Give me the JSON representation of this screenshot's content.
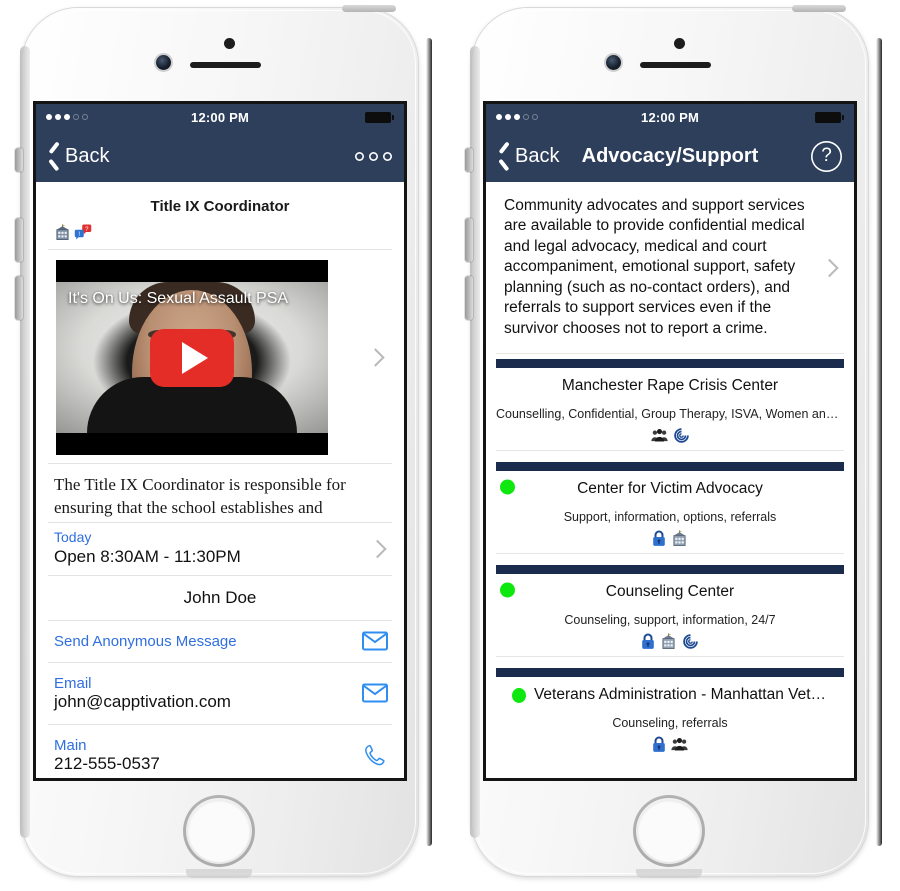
{
  "phones": {
    "left": {
      "statusbar": {
        "signal_filled": 3,
        "signal_empty": 2,
        "time": "12:00 PM"
      },
      "nav": {
        "back_label": "Back",
        "title": "",
        "right_icon": "kebab-more-icon"
      },
      "page_title": "Title IX Coordinator",
      "tag_icons": [
        "building-icon",
        "question-exclamation-bubbles-icon"
      ],
      "video": {
        "title": "It's On Us: Sexual Assault PSA",
        "play_icon": "youtube-play-icon"
      },
      "description": "The Title IX Coordinator is responsible for ensuring that the school establishes and",
      "hours": {
        "label": "Today",
        "value": "Open  8:30AM - 11:30PM"
      },
      "contact_name": "John Doe",
      "actions": [
        {
          "label": "Send Anonymous Message",
          "icon": "envelope-icon"
        }
      ],
      "fields": [
        {
          "label": "Email",
          "value": "john@capptivation.com",
          "icon": "envelope-icon"
        },
        {
          "label": "Main",
          "value": "212-555-0537",
          "icon": "phone-icon"
        }
      ]
    },
    "right": {
      "statusbar": {
        "signal_filled": 3,
        "signal_empty": 2,
        "time": "12:00 PM"
      },
      "nav": {
        "back_label": "Back",
        "title": "Advocacy/Support",
        "help_label": "?",
        "right_icon": "help-circle-icon"
      },
      "intro": "Community advocates and support services are available to provide confidential medical and legal advocacy, medical and court accompaniment, emotional support, safety planning (such as no-contact orders), and referrals to support services even if the survivor chooses not to report a crime.",
      "cards": [
        {
          "title": "Manchester Rape Crisis Center",
          "subtitle": "Counselling, Confidential, Group Therapy, ISVA, Women and girl…",
          "status_dot": false,
          "icons": [
            "group-people-icon",
            "swirl-icon"
          ]
        },
        {
          "title": "Center for Victim Advocacy",
          "subtitle": "Support, information, options, referrals",
          "status_dot": true,
          "icons": [
            "lock-icon",
            "building-icon"
          ]
        },
        {
          "title": "Counseling Center",
          "subtitle": "Counseling, support, information, 24/7",
          "status_dot": true,
          "icons": [
            "lock-icon",
            "building-icon",
            "swirl-icon"
          ]
        },
        {
          "title": "Veterans Administration - Manhattan Vet Ce…",
          "subtitle": "Counseling, referrals",
          "status_dot": true,
          "inline_dot": true,
          "icons": [
            "lock-icon",
            "group-people-icon"
          ]
        }
      ]
    }
  },
  "colors": {
    "navy": "#2e3f5c",
    "card_bar": "#1b2b4d",
    "link_blue": "#2f6fe0",
    "status_green": "#0ee80e",
    "youtube_red": "#e52d27"
  }
}
